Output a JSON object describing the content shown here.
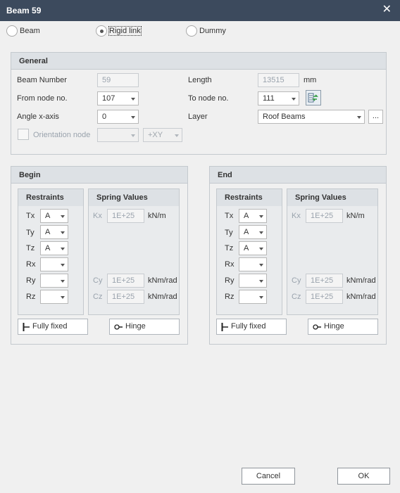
{
  "window": {
    "title": "Beam 59"
  },
  "beam_type": {
    "options": [
      "Beam",
      "Rigid link",
      "Dummy"
    ],
    "selected": "Rigid link"
  },
  "general": {
    "title": "General",
    "beam_number_label": "Beam Number",
    "beam_number_value": "59",
    "length_label": "Length",
    "length_value": "13515",
    "length_unit": "mm",
    "from_node_label": "From node no.",
    "from_node_value": "107",
    "to_node_label": "To node no.",
    "to_node_value": "111",
    "angle_label": "Angle x-axis",
    "angle_value": "0",
    "layer_label": "Layer",
    "layer_value": "Roof Beams",
    "layer_more": "...",
    "orientation_label": "Orientation node",
    "orientation_value": "",
    "orientation_axis": "+XY"
  },
  "begin": {
    "title": "Begin",
    "restraints_title": "Restraints",
    "spring_title": "Spring Values",
    "restraints": [
      {
        "label": "Tx",
        "value": "A"
      },
      {
        "label": "Ty",
        "value": "A"
      },
      {
        "label": "Tz",
        "value": "A"
      },
      {
        "label": "Rx",
        "value": ""
      },
      {
        "label": "Ry",
        "value": ""
      },
      {
        "label": "Rz",
        "value": ""
      }
    ],
    "springs": [
      {
        "label": "Kx",
        "value": "1E+25",
        "unit": "kN/m"
      },
      {
        "label": "Cy",
        "value": "1E+25",
        "unit": "kNm/rad"
      },
      {
        "label": "Cz",
        "value": "1E+25",
        "unit": "kNm/rad"
      }
    ],
    "fully_fixed_label": "Fully fixed",
    "hinge_label": "Hinge"
  },
  "end": {
    "title": "End",
    "restraints_title": "Restraints",
    "spring_title": "Spring Values",
    "restraints": [
      {
        "label": "Tx",
        "value": "A"
      },
      {
        "label": "Ty",
        "value": "A"
      },
      {
        "label": "Tz",
        "value": "A"
      },
      {
        "label": "Rx",
        "value": ""
      },
      {
        "label": "Ry",
        "value": ""
      },
      {
        "label": "Rz",
        "value": ""
      }
    ],
    "springs": [
      {
        "label": "Kx",
        "value": "1E+25",
        "unit": "kN/m"
      },
      {
        "label": "Cy",
        "value": "1E+25",
        "unit": "kNm/rad"
      },
      {
        "label": "Cz",
        "value": "1E+25",
        "unit": "kNm/rad"
      }
    ],
    "fully_fixed_label": "Fully fixed",
    "hinge_label": "Hinge"
  },
  "footer": {
    "cancel_label": "Cancel",
    "ok_label": "OK"
  }
}
